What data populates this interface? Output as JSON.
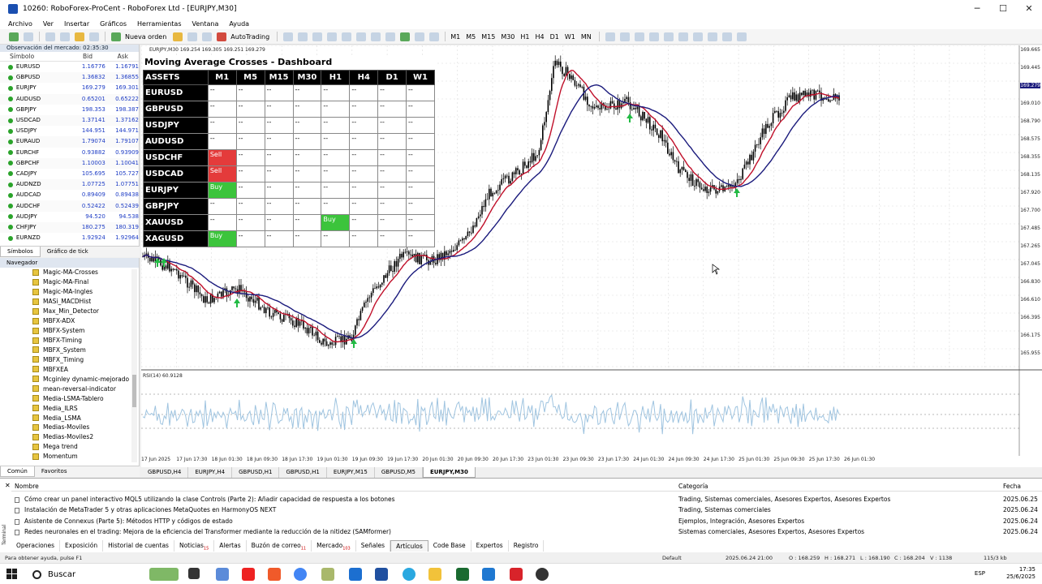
{
  "window": {
    "title": "10260: RoboForex-ProCent - RoboForex Ltd - [EURJPY,M30]",
    "minimize": "─",
    "maximize": "☐",
    "close": "✕"
  },
  "menu": [
    "Archivo",
    "Ver",
    "Insertar",
    "Gráficos",
    "Herramientas",
    "Ventana",
    "Ayuda"
  ],
  "toolbar": {
    "new_order": "Nueva orden",
    "autotrading": "AutoTrading",
    "timeframes": [
      "M1",
      "M5",
      "M15",
      "M30",
      "H1",
      "H4",
      "D1",
      "W1",
      "MN"
    ]
  },
  "market_watch": {
    "header": "Observación del mercado: 02:35:30",
    "columns": [
      "Símbolo",
      "Bid",
      "Ask"
    ],
    "rows": [
      {
        "sym": "EURUSD",
        "bid": "1.16776",
        "ask": "1.16791"
      },
      {
        "sym": "GBPUSD",
        "bid": "1.36832",
        "ask": "1.36855"
      },
      {
        "sym": "EURJPY",
        "bid": "169.279",
        "ask": "169.301"
      },
      {
        "sym": "AUDUSD",
        "bid": "0.65201",
        "ask": "0.65222"
      },
      {
        "sym": "GBPJPY",
        "bid": "198.353",
        "ask": "198.387"
      },
      {
        "sym": "USDCAD",
        "bid": "1.37141",
        "ask": "1.37162"
      },
      {
        "sym": "USDJPY",
        "bid": "144.951",
        "ask": "144.971"
      },
      {
        "sym": "EURAUD",
        "bid": "1.79074",
        "ask": "1.79107"
      },
      {
        "sym": "EURCHF",
        "bid": "0.93882",
        "ask": "0.93909"
      },
      {
        "sym": "GBPCHF",
        "bid": "1.10003",
        "ask": "1.10041"
      },
      {
        "sym": "CADJPY",
        "bid": "105.695",
        "ask": "105.727"
      },
      {
        "sym": "AUDNZD",
        "bid": "1.07725",
        "ask": "1.07751"
      },
      {
        "sym": "AUDCAD",
        "bid": "0.89409",
        "ask": "0.89438"
      },
      {
        "sym": "AUDCHF",
        "bid": "0.52422",
        "ask": "0.52439"
      },
      {
        "sym": "AUDJPY",
        "bid": "94.520",
        "ask": "94.538"
      },
      {
        "sym": "CHFJPY",
        "bid": "180.275",
        "ask": "180.319"
      },
      {
        "sym": "EURNZD",
        "bid": "1.92924",
        "ask": "1.92964"
      }
    ],
    "tabs": [
      "Símbolos",
      "Gráfico de tick"
    ]
  },
  "navigator": {
    "header": "Navegador",
    "items": [
      "Magic-MA-Crosses",
      "Magic-MA-Final",
      "Magic-MA-Ingles",
      "MASi_MACDHist",
      "Max_Min_Detector",
      "MBFX-ADX",
      "MBFX-System",
      "MBFX-Timing",
      "MBFX_System",
      "MBFX_Timing",
      "MBFXEA",
      "Mcginley dynamic-mejorado",
      "mean-reversal-indicator",
      "Media-LSMA-Tablero",
      "Media_ILRS",
      "Media_LSMA",
      "Medias-Moviles",
      "Medias-Moviles2",
      "Mega trend",
      "Momentum"
    ],
    "tabs": [
      "Común",
      "Favoritos"
    ]
  },
  "chart": {
    "info": "EURJPY,M30  169.254 169.305 169.251 169.279",
    "rsi_label": "RSI(14) 60.9128",
    "price_labels": [
      "169.665",
      "169.445",
      "169.279",
      "169.010",
      "168.790",
      "168.575",
      "168.355",
      "168.135",
      "167.920",
      "167.700",
      "167.485",
      "167.265",
      "167.045",
      "166.830",
      "166.610",
      "166.395",
      "166.175",
      "165.955"
    ],
    "rsi_levels": [
      "70",
      "50",
      "30",
      "0"
    ],
    "time_labels": [
      "17 Jun 2025",
      "17 Jun 17:30",
      "18 Jun 01:30",
      "18 Jun 09:30",
      "18 Jun 17:30",
      "19 Jun 01:30",
      "19 Jun 09:30",
      "19 Jun 17:30",
      "20 Jun 01:30",
      "20 Jun 09:30",
      "20 Jun 17:30",
      "23 Jun 01:30",
      "23 Jun 09:30",
      "23 Jun 17:30",
      "24 Jun 01:30",
      "24 Jun 09:30",
      "24 Jun 17:30",
      "25 Jun 01:30",
      "25 Jun 09:30",
      "25 Jun 17:30",
      "26 Jun 01:30"
    ],
    "colors": {
      "candles": "#000000",
      "ma_fast": "#c0102a",
      "ma_slow": "#1a1a7c",
      "arrows": "#22bb44",
      "rsi": "#9fc4e0"
    }
  },
  "dashboard": {
    "title": "Moving Average Crosses - Dashboard",
    "header": [
      "ASSETS",
      "M1",
      "M5",
      "M15",
      "M30",
      "H1",
      "H4",
      "D1",
      "W1"
    ],
    "rows": [
      {
        "asset": "EURUSD",
        "cells": [
          "--",
          "--",
          "--",
          "--",
          "--",
          "--",
          "--",
          "--"
        ]
      },
      {
        "asset": "GBPUSD",
        "cells": [
          "--",
          "--",
          "--",
          "--",
          "--",
          "--",
          "--",
          "--"
        ]
      },
      {
        "asset": "USDJPY",
        "cells": [
          "--",
          "--",
          "--",
          "--",
          "--",
          "--",
          "--",
          "--"
        ]
      },
      {
        "asset": "AUDUSD",
        "cells": [
          "--",
          "--",
          "--",
          "--",
          "--",
          "--",
          "--",
          "--"
        ]
      },
      {
        "asset": "USDCHF",
        "cells": [
          "Sell",
          "--",
          "--",
          "--",
          "--",
          "--",
          "--",
          "--"
        ]
      },
      {
        "asset": "USDCAD",
        "cells": [
          "Sell",
          "--",
          "--",
          "--",
          "--",
          "--",
          "--",
          "--"
        ]
      },
      {
        "asset": "EURJPY",
        "cells": [
          "Buy",
          "--",
          "--",
          "--",
          "--",
          "--",
          "--",
          "--"
        ]
      },
      {
        "asset": "GBPJPY",
        "cells": [
          "--",
          "--",
          "--",
          "--",
          "--",
          "--",
          "--",
          "--"
        ]
      },
      {
        "asset": "XAUUSD",
        "cells": [
          "--",
          "--",
          "--",
          "--",
          "Buy",
          "--",
          "--",
          "--"
        ]
      },
      {
        "asset": "XAGUSD",
        "cells": [
          "Buy",
          "--",
          "--",
          "--",
          "--",
          "--",
          "--",
          "--"
        ]
      }
    ],
    "colors": {
      "sell": "#e43b3b",
      "buy": "#3cc43c"
    }
  },
  "chart_tabs": [
    "GBPUSD,H4",
    "EURJPY,H4",
    "GBPUSD,H1",
    "GBPUSD,H1",
    "EURJPY,M15",
    "GBPUSD,M5",
    "EURJPY,M30"
  ],
  "toolbox": {
    "columns": [
      "Nombre",
      "Categoría",
      "Fecha"
    ],
    "articles": [
      {
        "name": "Cómo crear un panel interactivo MQL5 utilizando la clase Controls (Parte 2): Añadir capacidad de respuesta a los botones",
        "cat": "Trading, Sistemas comerciales, Asesores Expertos, Asesores Expertos",
        "date": "2025.06.25"
      },
      {
        "name": "Instalación de MetaTrader 5 y otras aplicaciones MetaQuotes en HarmonyOS NEXT",
        "cat": "Trading, Sistemas comerciales",
        "date": "2025.06.24"
      },
      {
        "name": "Asistente de Connexus (Parte 5): Métodos HTTP y códigos de estado",
        "cat": "Ejemplos, Integración, Asesores Expertos",
        "date": "2025.06.24"
      },
      {
        "name": "Redes neuronales en el trading: Mejora de la eficiencia del Transformer mediante la reducción de la nitidez (SAMformer)",
        "cat": "Sistemas comerciales, Asesores Expertos, Asesores Expertos",
        "date": "2025.06.24"
      }
    ],
    "tabs": [
      "Operaciones",
      "Exposición",
      "Historial de cuentas",
      "Noticias",
      "Alertas",
      "Buzón de correo",
      "Mercado",
      "Señales",
      "Artículos",
      "Code Base",
      "Expertos",
      "Registro"
    ],
    "tab_badges": {
      "noticias": "15",
      "correo": "11",
      "mercado": "103"
    },
    "side_label": "Terminal",
    "close": "✕"
  },
  "status": {
    "help": "Para obtener ayuda, pulse F1",
    "profile": "Default",
    "datetime": "2025.06.24 21:00",
    "o": "O : 168.259",
    "h": "H : 168.271",
    "l": "L : 168.190",
    "c": "C : 168.204",
    "v": "V : 1138",
    "traffic": "115/3 kb"
  },
  "taskbar": {
    "search": "Buscar",
    "lang": "ESP",
    "time": "17:35",
    "date": "25/6/2025"
  }
}
